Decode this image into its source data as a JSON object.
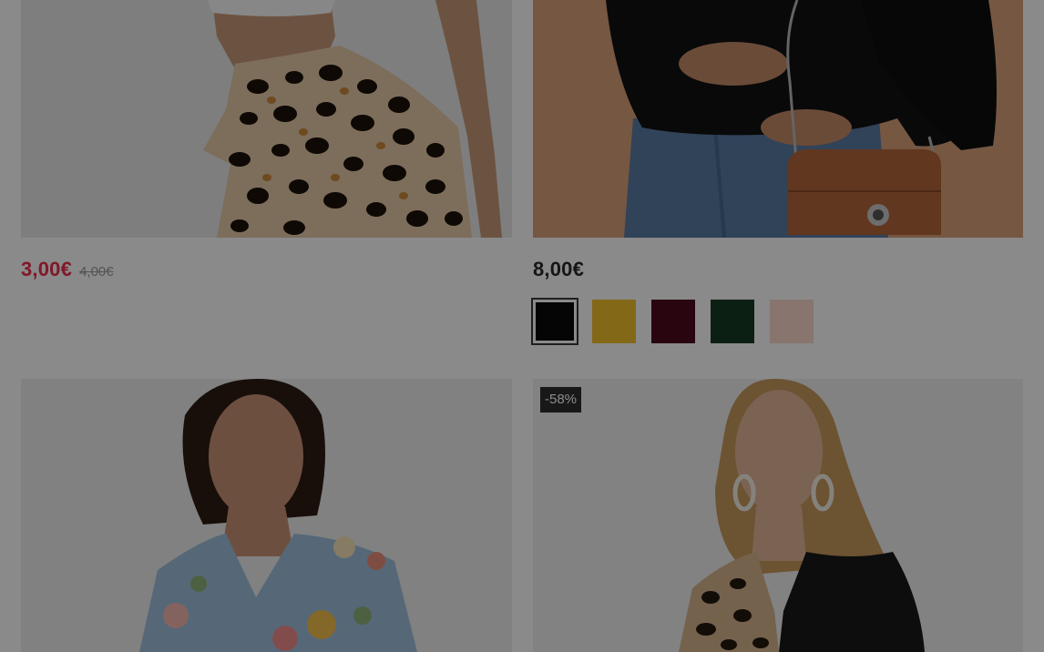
{
  "products": [
    {
      "price": "3,00€",
      "old_price": "4,00€",
      "image_icon": "leopard-skirt-image"
    },
    {
      "price": "8,00€",
      "image_icon": "black-top-with-bag-image",
      "swatches": [
        {
          "color": "#0a0a0a",
          "selected": true
        },
        {
          "color": "#f2c12e",
          "selected": false
        },
        {
          "color": "#4a0a1c",
          "selected": false
        },
        {
          "color": "#173a24",
          "selected": false
        },
        {
          "color": "#fad9cc",
          "selected": false
        }
      ]
    },
    {
      "image_icon": "floral-blouse-image"
    },
    {
      "badge": "-58%",
      "image_icon": "leopard-colorblock-blouse-image"
    }
  ],
  "colors": {
    "sale_price": "#ee2d4a",
    "overlay": "rgba(0,0,0,0.46)"
  }
}
